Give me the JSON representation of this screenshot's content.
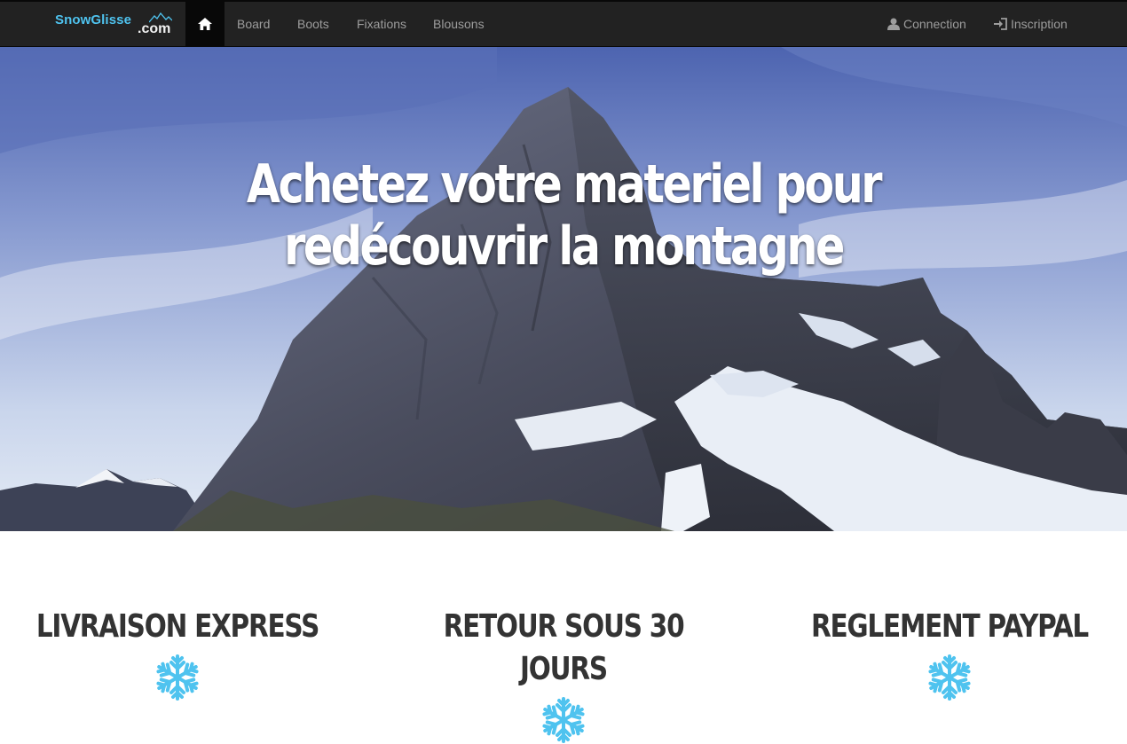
{
  "brand": {
    "name_part1": "SnowGlisse",
    "name_part2": ".com"
  },
  "nav": {
    "home_icon": "home-icon",
    "items": [
      {
        "label": "Board"
      },
      {
        "label": "Boots"
      },
      {
        "label": "Fixations"
      },
      {
        "label": "Blousons"
      }
    ],
    "right": [
      {
        "label": "Connection",
        "icon": "user-icon"
      },
      {
        "label": "Inscription",
        "icon": "log-in-icon"
      }
    ]
  },
  "hero": {
    "title_line1": "Achetez votre materiel pour",
    "title_line2": "redécouvrir la montagne",
    "slides_count": 3,
    "active_slide": 1
  },
  "features": [
    {
      "title": "LIVRAISON EXPRESS",
      "icon": "snowflake-icon"
    },
    {
      "title": "RETOUR SOUS 30 JOURS",
      "icon": "snowflake-icon"
    },
    {
      "title": "REGLEMENT PAYPAL",
      "icon": "snowflake-icon"
    }
  ],
  "colors": {
    "accent": "#4fc3ef",
    "navbar": "#222222",
    "nav_text": "#9d9d9d"
  }
}
